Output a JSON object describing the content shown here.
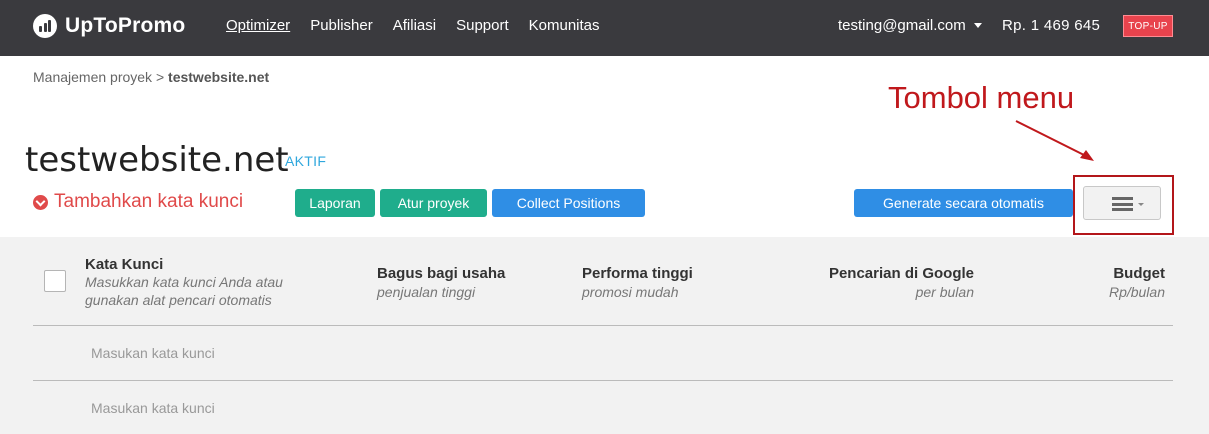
{
  "brand": {
    "name": "UpToPromo",
    "logo_icon": "bar-chart-logo-icon"
  },
  "nav": [
    {
      "label": "Optimizer",
      "active": true
    },
    {
      "label": "Publisher",
      "active": false
    },
    {
      "label": "Afiliasi",
      "active": false
    },
    {
      "label": "Support",
      "active": false
    },
    {
      "label": "Komunitas",
      "active": false
    }
  ],
  "account": {
    "email": "testing@gmail.com",
    "balance": "Rp.  1 469 645",
    "topup_label": "TOP-UP"
  },
  "breadcrumb": {
    "parent": "Manajemen proyek",
    "separator": ">",
    "current": "testwebsite.net"
  },
  "annotation": {
    "label": "Tombol menu",
    "color": "#c0181c"
  },
  "project": {
    "title": "testwebsite.net",
    "status": "AKTIF"
  },
  "actions": {
    "add_keyword": "Tambahkan kata kunci",
    "report": "Laporan",
    "settings": "Atur proyek",
    "collect": "Collect Positions",
    "generate": "Generate secara otomatis",
    "menu_icon": "hamburger-menu-icon"
  },
  "table": {
    "columns": [
      {
        "title": "Kata Kunci",
        "subtitle_lines": [
          "Masukkan kata kunci Anda atau",
          "gunakan alat pencari otomatis"
        ]
      },
      {
        "title": "Bagus bagi usaha",
        "subtitle": "penjualan tinggi"
      },
      {
        "title": "Performa tinggi",
        "subtitle": "promosi mudah"
      },
      {
        "title": "Pencarian di Google",
        "subtitle": "per bulan"
      },
      {
        "title": "Budget",
        "subtitle": "Rp/bulan"
      }
    ],
    "rows": [
      {
        "placeholder": "Masukan kata kunci"
      },
      {
        "placeholder": "Masukan kata kunci"
      }
    ]
  },
  "colors": {
    "topbar": "#3a3a3e",
    "green": "#1fad8c",
    "blue": "#2f8ee5",
    "danger": "#e04a4a",
    "status": "#2fa7dd",
    "topup": "#e8434d"
  }
}
